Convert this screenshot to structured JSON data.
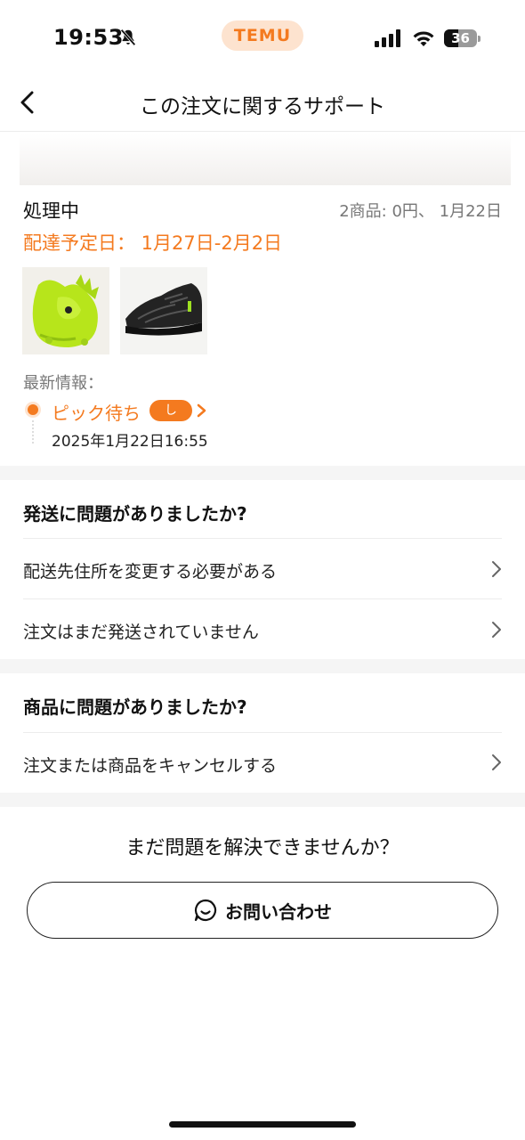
{
  "status_bar": {
    "time": "19:53",
    "brand": "TEMU",
    "battery": "36"
  },
  "nav": {
    "title": "この注文に関するサポート"
  },
  "order": {
    "status": "処理中",
    "summary": "2商品: 0円、 1月22日",
    "delivery": "配達予定日： 1月27日-2月2日",
    "latest_label": "最新情報：",
    "tracking_status": "ピック待ち",
    "tracking_badge": "し",
    "tracking_time": "2025年1月22日16:55"
  },
  "shipping_section": {
    "title": "発送に問題がありましたか?",
    "items": [
      {
        "label": "配送先住所を変更する必要がある"
      },
      {
        "label": "注文はまだ発送されていません"
      }
    ]
  },
  "product_section": {
    "title": "商品に問題がありましたか?",
    "items": [
      {
        "label": "注文または商品をキャンセルする"
      }
    ]
  },
  "help": {
    "title": "まだ問題を解決できませんか？",
    "contact_label": "お問い合わせ"
  },
  "icons": {
    "bell": "bell-slash-icon",
    "back": "chevron-left-icon",
    "row": "chevron-right-icon",
    "contact": "chat-bubble-icon"
  },
  "colors": {
    "accent": "#f47a1f",
    "accent_light": "#fde3cf"
  }
}
